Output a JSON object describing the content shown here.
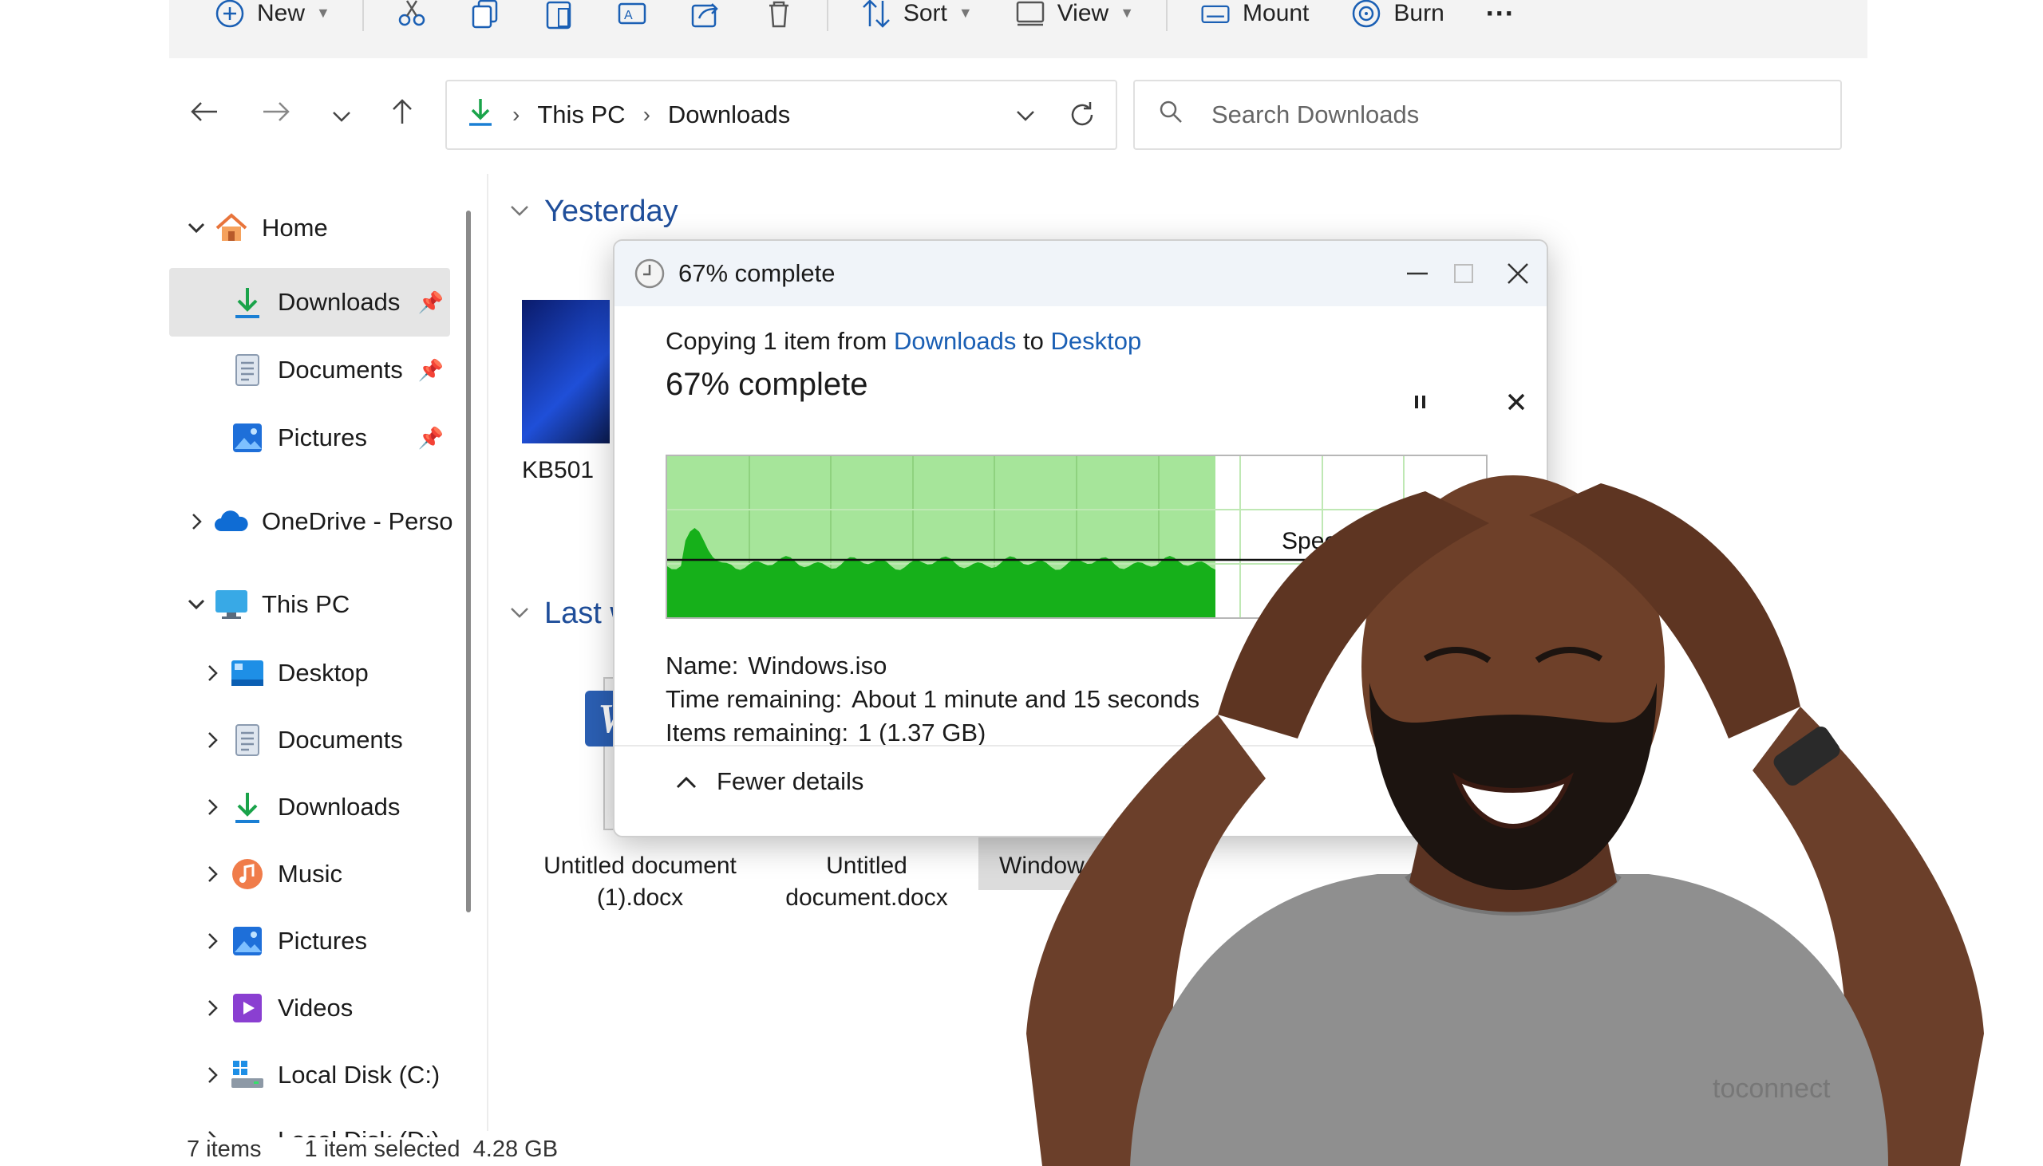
{
  "toolbar": {
    "new_label": "New",
    "sort_label": "Sort",
    "view_label": "View",
    "mount_label": "Mount",
    "burn_label": "Burn",
    "more_label": "···"
  },
  "address_bar": {
    "crumbs": [
      "This PC",
      "Downloads"
    ]
  },
  "search": {
    "placeholder": "Search Downloads"
  },
  "sidebar": {
    "items": [
      {
        "label": "Home"
      },
      {
        "label": "Downloads"
      },
      {
        "label": "Documents"
      },
      {
        "label": "Pictures"
      },
      {
        "label": "OneDrive - Perso"
      },
      {
        "label": "This PC"
      },
      {
        "label": "Desktop"
      },
      {
        "label": "Documents"
      },
      {
        "label": "Downloads"
      },
      {
        "label": "Music"
      },
      {
        "label": "Pictures"
      },
      {
        "label": "Videos"
      },
      {
        "label": "Local Disk (C:)"
      },
      {
        "label": "Local Disk (D:)"
      }
    ]
  },
  "content": {
    "groups": [
      {
        "label": "Yesterday"
      },
      {
        "label": "Last w"
      }
    ],
    "files": [
      {
        "name": "KB501"
      },
      {
        "name": "Untitled document (1).docx"
      },
      {
        "name": "Untitled document.docx"
      },
      {
        "name": "Window"
      }
    ]
  },
  "status_bar": {
    "item_count": "7 items",
    "selection": "1 item selected  4.28 GB"
  },
  "dialog": {
    "title": "67% complete",
    "copying_prefix": "Copying 1 item from ",
    "source": "Downloads",
    "to_word": " to ",
    "destination": "Desktop",
    "progress_text": "67% complete",
    "progress": 0.67,
    "speed_label": "Speed: 28",
    "name_label": "Name:",
    "name_value": "Windows.iso",
    "time_label": "Time remaining:",
    "time_value": "About 1 minute and 15 seconds",
    "items_label": "Items remaining:",
    "items_value": "1 (1.37 GB)",
    "fewer_details": "Fewer details"
  },
  "watermark": "toconnect",
  "colors": {
    "accent": "#1a5fb4",
    "graph_fill_dark": "#16b01a",
    "graph_fill_light": "#a6e59a",
    "folder_blue": "#1f4e9a"
  }
}
